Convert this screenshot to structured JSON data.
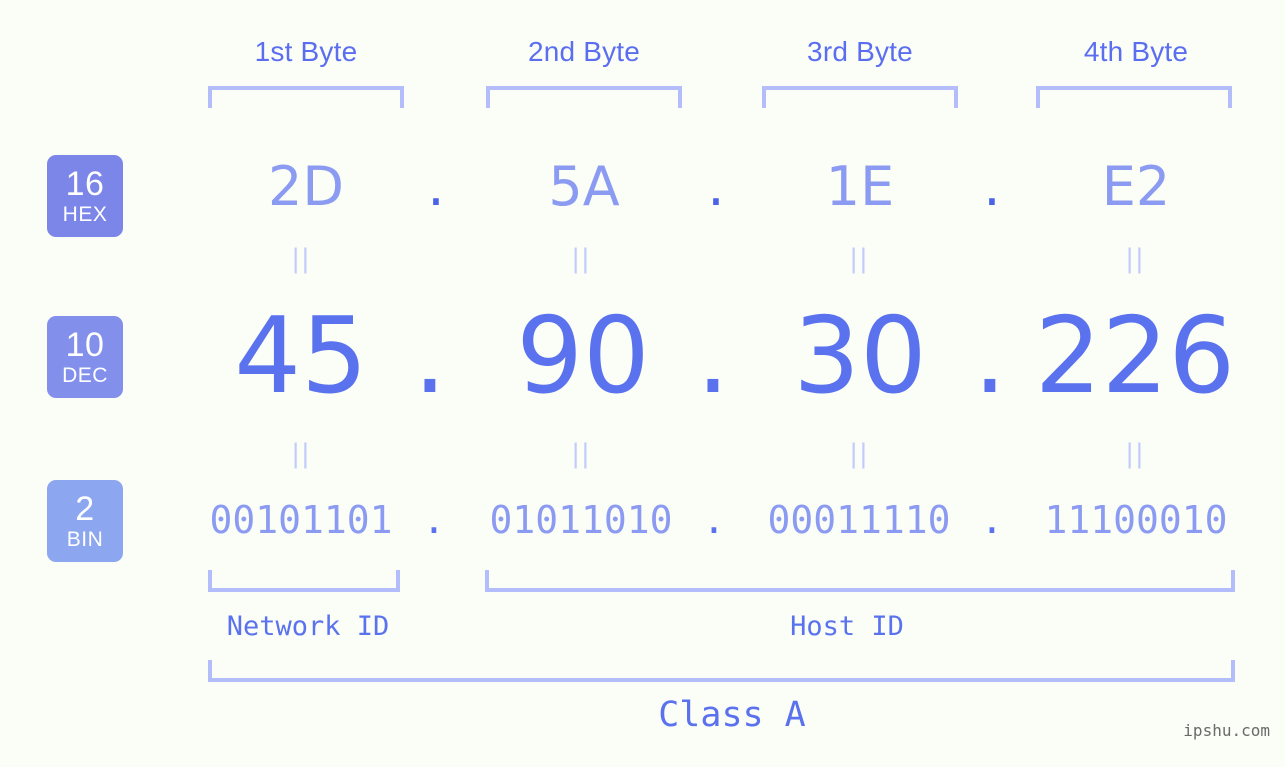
{
  "ip_address": "45.90.30.226",
  "colors": {
    "background": "#fbfdf7",
    "badge_hex": "#7b86e8",
    "badge_dec": "#8290ec",
    "badge_bin": "#8ca6f0",
    "bracket": "#b3bdfb",
    "equals": "#c2cbfb",
    "hex_text": "#8c9bf2",
    "dec_text": "#5b72ef",
    "bin_text": "#8c9bf2",
    "label_text": "#5b6ef0",
    "watermark_text": "#6a6a6a"
  },
  "byte_headers": [
    {
      "label": "1st Byte"
    },
    {
      "label": "2nd Byte"
    },
    {
      "label": "3rd Byte"
    },
    {
      "label": "4th Byte"
    }
  ],
  "radix_badges": [
    {
      "num": "16",
      "unit": "HEX"
    },
    {
      "num": "10",
      "unit": "DEC"
    },
    {
      "num": "2",
      "unit": "BIN"
    }
  ],
  "rows": {
    "hex": {
      "values": [
        "2D",
        "5A",
        "1E",
        "E2"
      ],
      "separator": "."
    },
    "dec": {
      "values": [
        "45",
        "90",
        "30",
        "226"
      ],
      "separator": "."
    },
    "bin": {
      "values": [
        "00101101",
        "01011010",
        "00011110",
        "11100010"
      ],
      "separator": "."
    }
  },
  "equals_mark": "||",
  "segments": {
    "network_id": "Network ID",
    "host_id": "Host ID"
  },
  "class_label": "Class A",
  "watermark": "ipshu.com"
}
